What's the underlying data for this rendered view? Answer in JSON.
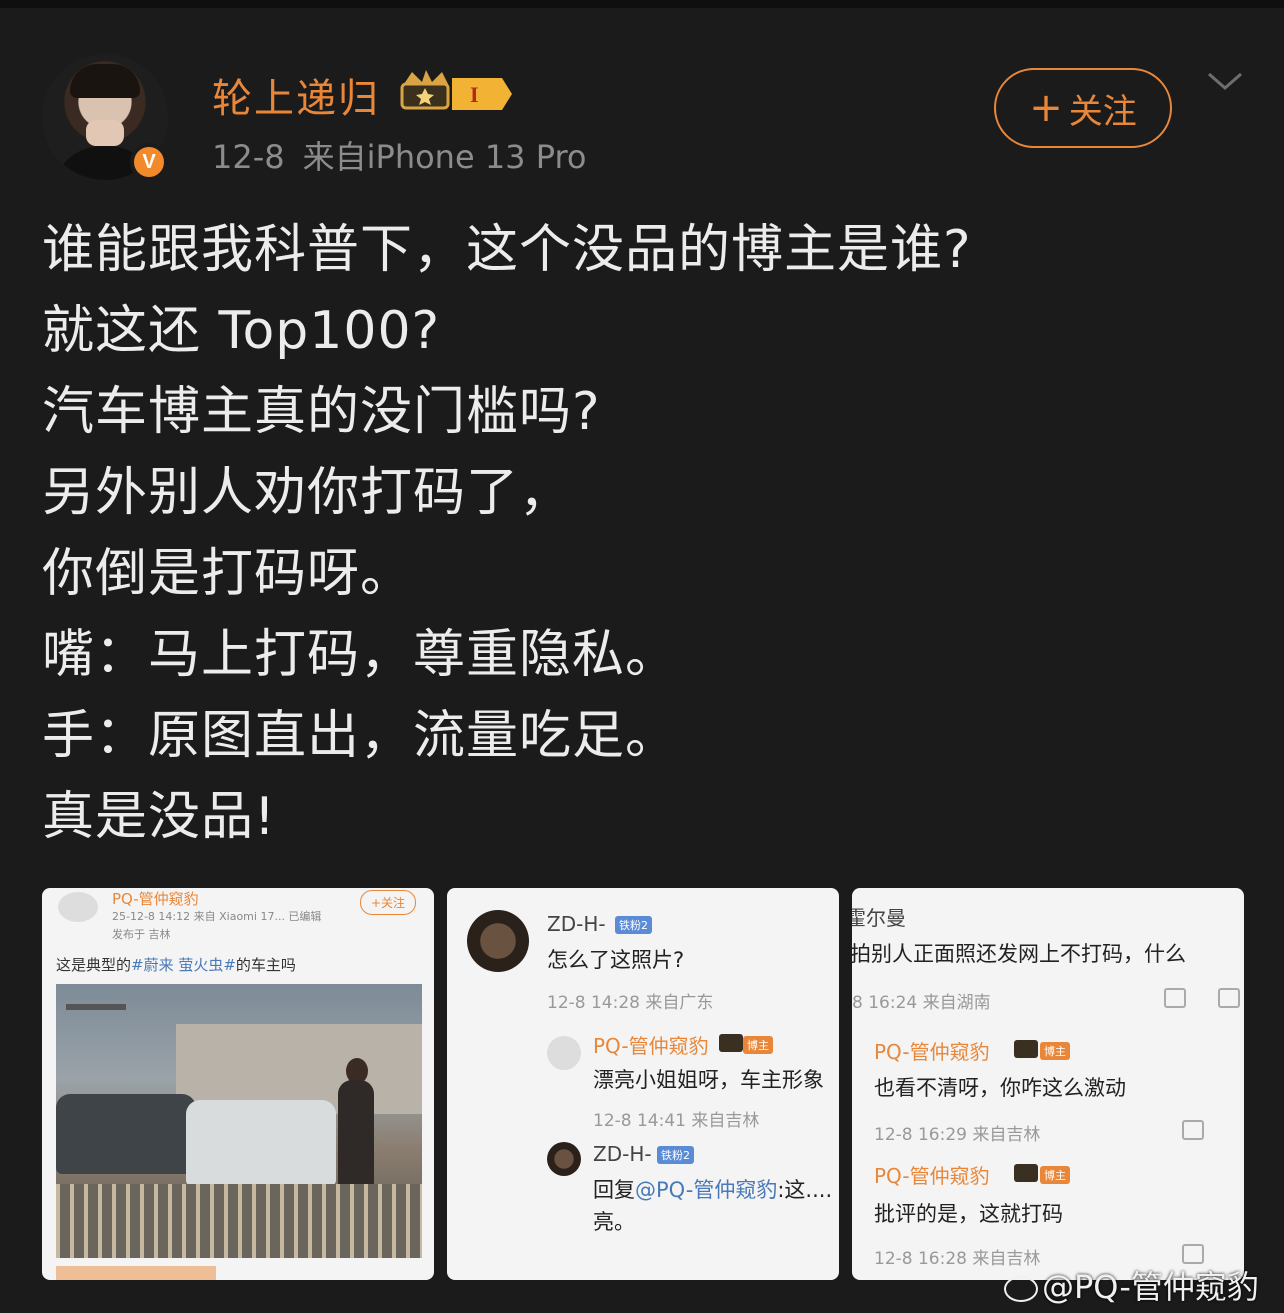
{
  "header": {
    "username": "轮上递归",
    "level": "I",
    "date": "12-8",
    "source": "来自iPhone 13 Pro",
    "follow_label": "关注",
    "verified_badge": "V"
  },
  "post": {
    "lines": [
      "谁能跟我科普下，这个没品的博主是谁?",
      "就这还 Top100?",
      "汽车博主真的没门槛吗?",
      "另外别人劝你打码了，",
      "你倒是打码呀。",
      "嘴：马上打码，尊重隐私。",
      "手：原图直出，流量吃足。",
      "真是没品!"
    ]
  },
  "thumbs": {
    "t1": {
      "name": "PQ-管仲窥豹",
      "meta": "25-12-8 14:12  来自 Xiaomi 17...  已编辑",
      "meta2": "发布于 吉林",
      "follow": "+关注",
      "text_pre": "这是典型的",
      "tag": "#蔚来 萤火虫#",
      "text_post": "的车主吗"
    },
    "t2": {
      "c1_name": "ZD-H-",
      "c1_badge": "铁粉2",
      "c1_text": "怎么了这照片?",
      "c1_time": "12-8 14:28  来自广东",
      "c2_name": "PQ-管仲窥豹",
      "c2_badge": "博主",
      "c2_text": "漂亮小姐姐呀，车主形象",
      "c2_time": "12-8 14:41  来自吉林",
      "c3_name": "ZD-H-",
      "c3_badge": "铁粉2",
      "c3_text_pre": "回复",
      "c3_at": "@PQ-管仲窥豹",
      "c3_text_post": ":这....",
      "c3_text2": "亮。"
    },
    "t3": {
      "c1_name": "霍尔曼",
      "c1_text": "拍别人正面照还发网上不打码，什么",
      "c1_time": "8 16:24  来自湖南",
      "c2_name": "PQ-管仲窥豹",
      "c2_badge": "博主",
      "c2_text": "也看不清呀，你咋这么激动",
      "c2_time": "12-8 16:29  来自吉林",
      "c3_name": "PQ-管仲窥豹",
      "c3_badge": "博主",
      "c3_text": "批评的是，这就打码",
      "c3_time": "12-8 16:28  来自吉林"
    }
  },
  "watermark": "@PQ-管仲窥豹",
  "colors": {
    "background": "#1b1b1b",
    "accent": "#e8873a",
    "text": "#ececec",
    "meta": "#8c8c8c"
  }
}
